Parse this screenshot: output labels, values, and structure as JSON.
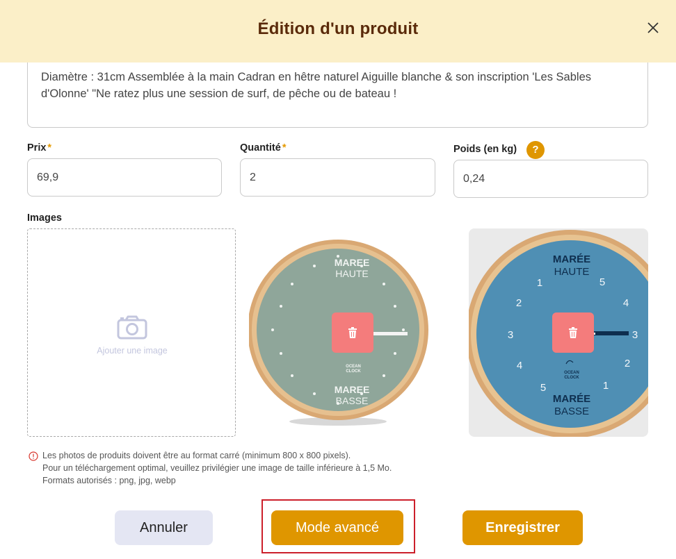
{
  "dialog": {
    "title": "Édition d'un produit"
  },
  "description": {
    "text": "Diamètre : 31cm Assemblée à la main Cadran en hêtre naturel Aiguille blanche & son inscription 'Les Sables d'Olonne' \"Ne ratez plus une session de surf, de pêche ou de bateau !"
  },
  "fields": {
    "price": {
      "label": "Prix",
      "required_mark": "*",
      "value": "69,9"
    },
    "quantity": {
      "label": "Quantité",
      "required_mark": "*",
      "value": "2"
    },
    "weight": {
      "label": "Poids (en kg)",
      "help": "?",
      "value": "0,24"
    }
  },
  "images": {
    "label": "Images",
    "add_text": "Ajouter une image",
    "items": [
      {
        "name": "green-clock",
        "face_color": "#8fa69a",
        "text_color": "#f1f4f2",
        "top_word1": "MAREE",
        "top_word2": "HAUTE",
        "bottom_word1": "MAREE",
        "bottom_word2": "BASSE",
        "brand1": "OCEAN",
        "brand2": "CLOCK"
      },
      {
        "name": "blue-clock",
        "face_color": "#4f8fb4",
        "text_color": "#0e2e4e",
        "top_word1": "MARÉE",
        "top_word2": "HAUTE",
        "bottom_word1": "MARÉE",
        "bottom_word2": "BASSE",
        "brand1": "OCEAN",
        "brand2": "CLOCK",
        "numbers": [
          "1",
          "2",
          "3",
          "4",
          "5",
          "5",
          "4",
          "3",
          "2",
          "1"
        ]
      }
    ]
  },
  "info": {
    "lines": [
      "Les photos de produits doivent être au format carré (minimum 800 x 800 pixels).",
      "Pour un téléchargement optimal, veuillez privilégier une image de taille inférieure à 1,5 Mo.",
      "Formats autorisés : png, jpg, webp"
    ]
  },
  "buttons": {
    "cancel": "Annuler",
    "advanced": "Mode avancé",
    "save": "Enregistrer"
  },
  "colors": {
    "accent": "#df9600",
    "header_bg": "#fbefc8",
    "delete": "#f47c7c",
    "highlight": "#cc1f2a"
  }
}
